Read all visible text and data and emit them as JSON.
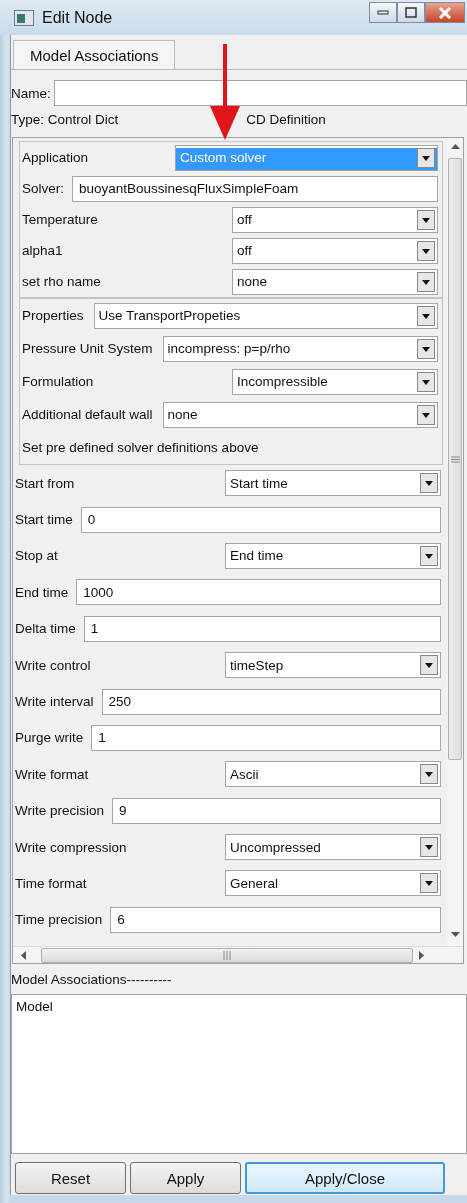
{
  "window": {
    "title": "Edit Node"
  },
  "tab": {
    "label": "Model Associations"
  },
  "name_field": {
    "label": "Name:"
  },
  "type_label": "Type: Control Dict",
  "definition_label": "CD Definition",
  "groups": [
    {
      "framed": true,
      "rows": [
        {
          "kind": "choice-mid",
          "label": "Application",
          "value": "Custom solver",
          "highlighted": true
        },
        {
          "kind": "text",
          "label": "Solver:",
          "value": "buoyantBoussinesqFluxSimpleFoam"
        },
        {
          "kind": "choice",
          "label": "Temperature",
          "value": "off",
          "highlighted": false
        },
        {
          "kind": "choice",
          "label": "alpha1",
          "value": "off",
          "highlighted": false
        },
        {
          "kind": "choice",
          "label": "set rho name",
          "value": "none",
          "highlighted": false
        }
      ]
    },
    {
      "framed": true,
      "rows": [
        {
          "kind": "choice-inline",
          "label": "Properties",
          "value": "Use TransportPropeties",
          "highlighted": false
        },
        {
          "kind": "choice-inline",
          "label": "Pressure Unit System",
          "value": "incompress: p=p/rho",
          "highlighted": false
        },
        {
          "kind": "choice",
          "label": "Formulation",
          "value": "Incompressible",
          "highlighted": false
        },
        {
          "kind": "choice-inline",
          "label": "Additional default wall",
          "value": "none",
          "highlighted": false
        },
        {
          "kind": "note",
          "label": "Set pre defined solver definitions above"
        }
      ]
    },
    {
      "framed": false,
      "rows": [
        {
          "kind": "choice",
          "label": "Start from",
          "value": "Start time",
          "highlighted": false
        },
        {
          "kind": "text",
          "label": "Start time",
          "value": "0"
        },
        {
          "kind": "choice",
          "label": "Stop at",
          "value": "End time",
          "highlighted": false
        },
        {
          "kind": "text",
          "label": "End time",
          "value": "1000"
        },
        {
          "kind": "text",
          "label": "Delta time",
          "value": "1"
        },
        {
          "kind": "choice",
          "label": "Write control",
          "value": "timeStep",
          "highlighted": false
        },
        {
          "kind": "text",
          "label": "Write interval",
          "value": "250"
        },
        {
          "kind": "text",
          "label": "Purge write",
          "value": "1"
        },
        {
          "kind": "choice",
          "label": "Write format",
          "value": "Ascii",
          "highlighted": false
        },
        {
          "kind": "text",
          "label": "Write precision",
          "value": "9"
        },
        {
          "kind": "choice",
          "label": "Write compression",
          "value": "Uncompressed",
          "highlighted": false
        },
        {
          "kind": "choice",
          "label": "Time format",
          "value": "General",
          "highlighted": false
        },
        {
          "kind": "text",
          "label": "Time precision",
          "value": "6"
        }
      ]
    }
  ],
  "associations": {
    "label": "Model Associations----------",
    "items": [
      "Model"
    ]
  },
  "buttons": [
    {
      "label": "Reset",
      "default": false
    },
    {
      "label": "Apply",
      "default": false
    },
    {
      "label": "Apply/Close",
      "default": true
    }
  ]
}
